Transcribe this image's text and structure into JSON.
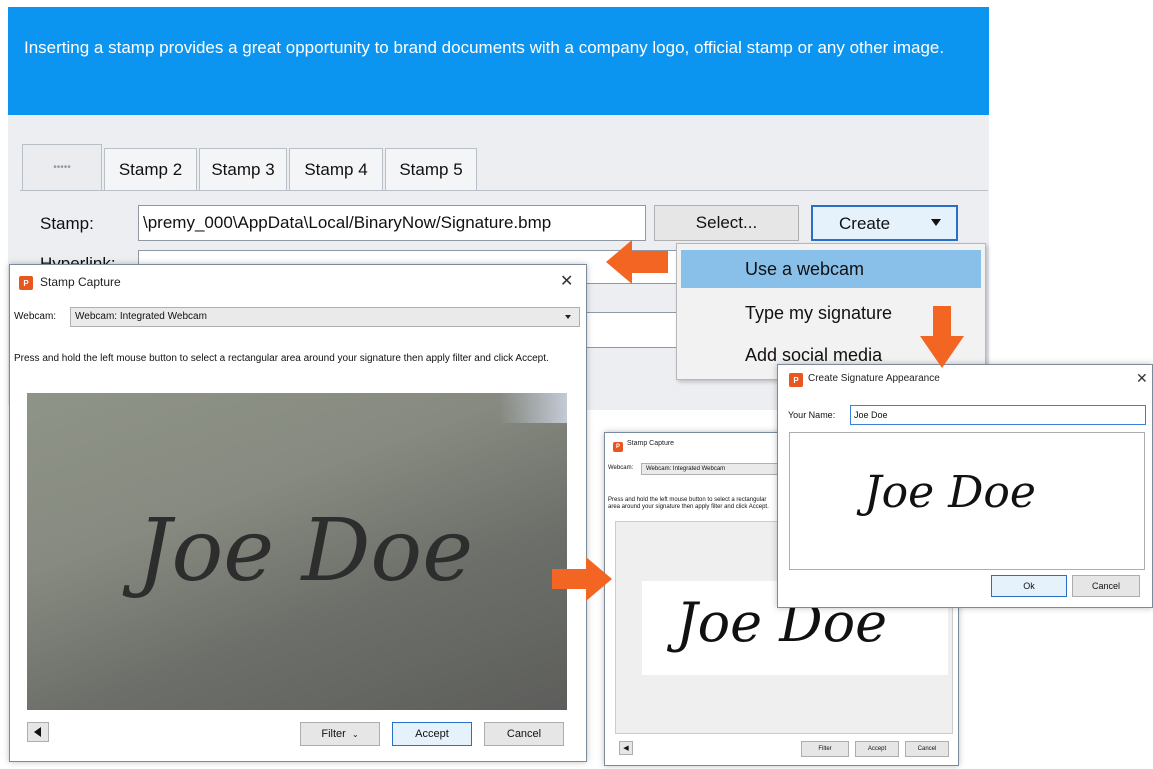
{
  "banner": {
    "text": "Inserting a stamp provides a great opportunity to brand documents with a company logo, official stamp or any other image."
  },
  "tabs": [
    {
      "label": "•••••"
    },
    {
      "label": "Stamp 2"
    },
    {
      "label": "Stamp 3"
    },
    {
      "label": "Stamp 4"
    },
    {
      "label": "Stamp 5"
    }
  ],
  "stamp": {
    "label": "Stamp:",
    "path": "\\premy_000\\AppData\\Local/BinaryNow/Signature.bmp",
    "select_label": "Select...",
    "create_label": "Create"
  },
  "hyperlink": {
    "label": "Hyperlink:"
  },
  "dropdown": {
    "items": [
      "Use a webcam",
      "Type my signature",
      "Add social media"
    ]
  },
  "capture_window": {
    "title": "Stamp Capture",
    "close": "✕",
    "webcam_label": "Webcam:",
    "webcam_value": "Webcam: Integrated Webcam",
    "instructions": "Press and hold the left mouse button to select a rectangular area around your signature then apply filter and click Accept.",
    "signature": "Joe Doe",
    "filter_label": "Filter",
    "accept_label": "Accept",
    "cancel_label": "Cancel"
  },
  "capture_window_small": {
    "title": "Stamp Capture",
    "webcam_label": "Webcam:",
    "webcam_value": "Webcam: Integrated Webcam",
    "instructions": "Press and hold the left mouse button to select a rectangular area around your signature then apply filter and click Accept.",
    "signature": "Joe Doe",
    "filter_label": "Filter",
    "accept_label": "Accept",
    "cancel_label": "Cancel"
  },
  "signature_window": {
    "title": "Create Signature Appearance",
    "close": "✕",
    "name_label": "Your Name:",
    "name_value": "Joe Doe",
    "signature": "Joe Doe",
    "ok_label": "Ok",
    "cancel_label": "Cancel"
  },
  "colors": {
    "banner": "#0b95f1",
    "arrow": "#f26522",
    "highlight": "#88c0ea"
  }
}
